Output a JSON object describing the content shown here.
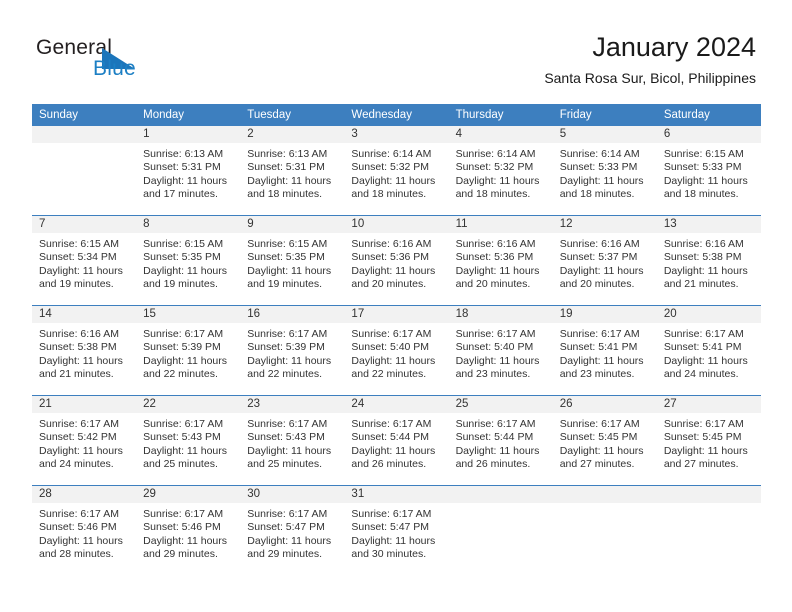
{
  "brand": {
    "word_one": "General",
    "word_two": "Blue",
    "triangle_icon": "brand-triangle-icon"
  },
  "header": {
    "title": "January 2024",
    "subtitle": "Santa Rosa Sur, Bicol, Philippines"
  },
  "calendar": {
    "weekday_headers": [
      "Sunday",
      "Monday",
      "Tuesday",
      "Wednesday",
      "Thursday",
      "Friday",
      "Saturday"
    ],
    "accent_color": "#3d7fbf",
    "daynum_band_color": "#f2f2f2",
    "weeks": [
      [
        {
          "day": "",
          "sunrise": "",
          "sunset": "",
          "daylight_line1": "",
          "daylight_line2": ""
        },
        {
          "day": "1",
          "sunrise": "Sunrise: 6:13 AM",
          "sunset": "Sunset: 5:31 PM",
          "daylight_line1": "Daylight: 11 hours",
          "daylight_line2": "and 17 minutes."
        },
        {
          "day": "2",
          "sunrise": "Sunrise: 6:13 AM",
          "sunset": "Sunset: 5:31 PM",
          "daylight_line1": "Daylight: 11 hours",
          "daylight_line2": "and 18 minutes."
        },
        {
          "day": "3",
          "sunrise": "Sunrise: 6:14 AM",
          "sunset": "Sunset: 5:32 PM",
          "daylight_line1": "Daylight: 11 hours",
          "daylight_line2": "and 18 minutes."
        },
        {
          "day": "4",
          "sunrise": "Sunrise: 6:14 AM",
          "sunset": "Sunset: 5:32 PM",
          "daylight_line1": "Daylight: 11 hours",
          "daylight_line2": "and 18 minutes."
        },
        {
          "day": "5",
          "sunrise": "Sunrise: 6:14 AM",
          "sunset": "Sunset: 5:33 PM",
          "daylight_line1": "Daylight: 11 hours",
          "daylight_line2": "and 18 minutes."
        },
        {
          "day": "6",
          "sunrise": "Sunrise: 6:15 AM",
          "sunset": "Sunset: 5:33 PM",
          "daylight_line1": "Daylight: 11 hours",
          "daylight_line2": "and 18 minutes."
        }
      ],
      [
        {
          "day": "7",
          "sunrise": "Sunrise: 6:15 AM",
          "sunset": "Sunset: 5:34 PM",
          "daylight_line1": "Daylight: 11 hours",
          "daylight_line2": "and 19 minutes."
        },
        {
          "day": "8",
          "sunrise": "Sunrise: 6:15 AM",
          "sunset": "Sunset: 5:35 PM",
          "daylight_line1": "Daylight: 11 hours",
          "daylight_line2": "and 19 minutes."
        },
        {
          "day": "9",
          "sunrise": "Sunrise: 6:15 AM",
          "sunset": "Sunset: 5:35 PM",
          "daylight_line1": "Daylight: 11 hours",
          "daylight_line2": "and 19 minutes."
        },
        {
          "day": "10",
          "sunrise": "Sunrise: 6:16 AM",
          "sunset": "Sunset: 5:36 PM",
          "daylight_line1": "Daylight: 11 hours",
          "daylight_line2": "and 20 minutes."
        },
        {
          "day": "11",
          "sunrise": "Sunrise: 6:16 AM",
          "sunset": "Sunset: 5:36 PM",
          "daylight_line1": "Daylight: 11 hours",
          "daylight_line2": "and 20 minutes."
        },
        {
          "day": "12",
          "sunrise": "Sunrise: 6:16 AM",
          "sunset": "Sunset: 5:37 PM",
          "daylight_line1": "Daylight: 11 hours",
          "daylight_line2": "and 20 minutes."
        },
        {
          "day": "13",
          "sunrise": "Sunrise: 6:16 AM",
          "sunset": "Sunset: 5:38 PM",
          "daylight_line1": "Daylight: 11 hours",
          "daylight_line2": "and 21 minutes."
        }
      ],
      [
        {
          "day": "14",
          "sunrise": "Sunrise: 6:16 AM",
          "sunset": "Sunset: 5:38 PM",
          "daylight_line1": "Daylight: 11 hours",
          "daylight_line2": "and 21 minutes."
        },
        {
          "day": "15",
          "sunrise": "Sunrise: 6:17 AM",
          "sunset": "Sunset: 5:39 PM",
          "daylight_line1": "Daylight: 11 hours",
          "daylight_line2": "and 22 minutes."
        },
        {
          "day": "16",
          "sunrise": "Sunrise: 6:17 AM",
          "sunset": "Sunset: 5:39 PM",
          "daylight_line1": "Daylight: 11 hours",
          "daylight_line2": "and 22 minutes."
        },
        {
          "day": "17",
          "sunrise": "Sunrise: 6:17 AM",
          "sunset": "Sunset: 5:40 PM",
          "daylight_line1": "Daylight: 11 hours",
          "daylight_line2": "and 22 minutes."
        },
        {
          "day": "18",
          "sunrise": "Sunrise: 6:17 AM",
          "sunset": "Sunset: 5:40 PM",
          "daylight_line1": "Daylight: 11 hours",
          "daylight_line2": "and 23 minutes."
        },
        {
          "day": "19",
          "sunrise": "Sunrise: 6:17 AM",
          "sunset": "Sunset: 5:41 PM",
          "daylight_line1": "Daylight: 11 hours",
          "daylight_line2": "and 23 minutes."
        },
        {
          "day": "20",
          "sunrise": "Sunrise: 6:17 AM",
          "sunset": "Sunset: 5:41 PM",
          "daylight_line1": "Daylight: 11 hours",
          "daylight_line2": "and 24 minutes."
        }
      ],
      [
        {
          "day": "21",
          "sunrise": "Sunrise: 6:17 AM",
          "sunset": "Sunset: 5:42 PM",
          "daylight_line1": "Daylight: 11 hours",
          "daylight_line2": "and 24 minutes."
        },
        {
          "day": "22",
          "sunrise": "Sunrise: 6:17 AM",
          "sunset": "Sunset: 5:43 PM",
          "daylight_line1": "Daylight: 11 hours",
          "daylight_line2": "and 25 minutes."
        },
        {
          "day": "23",
          "sunrise": "Sunrise: 6:17 AM",
          "sunset": "Sunset: 5:43 PM",
          "daylight_line1": "Daylight: 11 hours",
          "daylight_line2": "and 25 minutes."
        },
        {
          "day": "24",
          "sunrise": "Sunrise: 6:17 AM",
          "sunset": "Sunset: 5:44 PM",
          "daylight_line1": "Daylight: 11 hours",
          "daylight_line2": "and 26 minutes."
        },
        {
          "day": "25",
          "sunrise": "Sunrise: 6:17 AM",
          "sunset": "Sunset: 5:44 PM",
          "daylight_line1": "Daylight: 11 hours",
          "daylight_line2": "and 26 minutes."
        },
        {
          "day": "26",
          "sunrise": "Sunrise: 6:17 AM",
          "sunset": "Sunset: 5:45 PM",
          "daylight_line1": "Daylight: 11 hours",
          "daylight_line2": "and 27 minutes."
        },
        {
          "day": "27",
          "sunrise": "Sunrise: 6:17 AM",
          "sunset": "Sunset: 5:45 PM",
          "daylight_line1": "Daylight: 11 hours",
          "daylight_line2": "and 27 minutes."
        }
      ],
      [
        {
          "day": "28",
          "sunrise": "Sunrise: 6:17 AM",
          "sunset": "Sunset: 5:46 PM",
          "daylight_line1": "Daylight: 11 hours",
          "daylight_line2": "and 28 minutes."
        },
        {
          "day": "29",
          "sunrise": "Sunrise: 6:17 AM",
          "sunset": "Sunset: 5:46 PM",
          "daylight_line1": "Daylight: 11 hours",
          "daylight_line2": "and 29 minutes."
        },
        {
          "day": "30",
          "sunrise": "Sunrise: 6:17 AM",
          "sunset": "Sunset: 5:47 PM",
          "daylight_line1": "Daylight: 11 hours",
          "daylight_line2": "and 29 minutes."
        },
        {
          "day": "31",
          "sunrise": "Sunrise: 6:17 AM",
          "sunset": "Sunset: 5:47 PM",
          "daylight_line1": "Daylight: 11 hours",
          "daylight_line2": "and 30 minutes."
        },
        {
          "day": "",
          "sunrise": "",
          "sunset": "",
          "daylight_line1": "",
          "daylight_line2": ""
        },
        {
          "day": "",
          "sunrise": "",
          "sunset": "",
          "daylight_line1": "",
          "daylight_line2": ""
        },
        {
          "day": "",
          "sunrise": "",
          "sunset": "",
          "daylight_line1": "",
          "daylight_line2": ""
        }
      ]
    ]
  }
}
